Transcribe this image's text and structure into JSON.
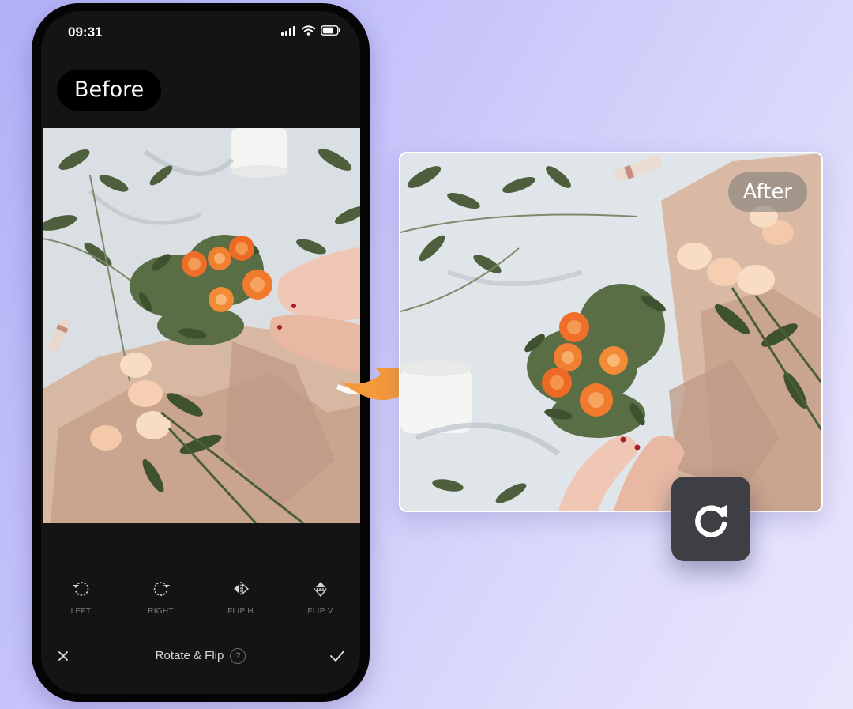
{
  "status_bar": {
    "time": "09:31",
    "icons": [
      "signal-icon",
      "wifi-icon",
      "battery-icon"
    ]
  },
  "before_label": "Before",
  "after_label": "After",
  "tools": [
    {
      "label": "LEFT",
      "icon": "rotate-left-icon"
    },
    {
      "label": "RIGHT",
      "icon": "rotate-right-icon"
    },
    {
      "label": "FLIP H",
      "icon": "flip-horizontal-icon"
    },
    {
      "label": "FLIP V",
      "icon": "flip-vertical-icon"
    }
  ],
  "bottom_bar": {
    "title": "Rotate & Flip",
    "help": "?",
    "close_icon": "close-icon",
    "confirm_icon": "check-icon"
  },
  "rotate_button_icon": "rotate-clockwise-icon",
  "colors": {
    "background_start": "#b3b1f7",
    "background_end": "#e8e6fc",
    "phone_body": "#050505",
    "screen": "#141414",
    "arrow_orange": "#f49a3a",
    "rotate_button": "#3e3f44",
    "tool_label": "#7c7c7c"
  }
}
